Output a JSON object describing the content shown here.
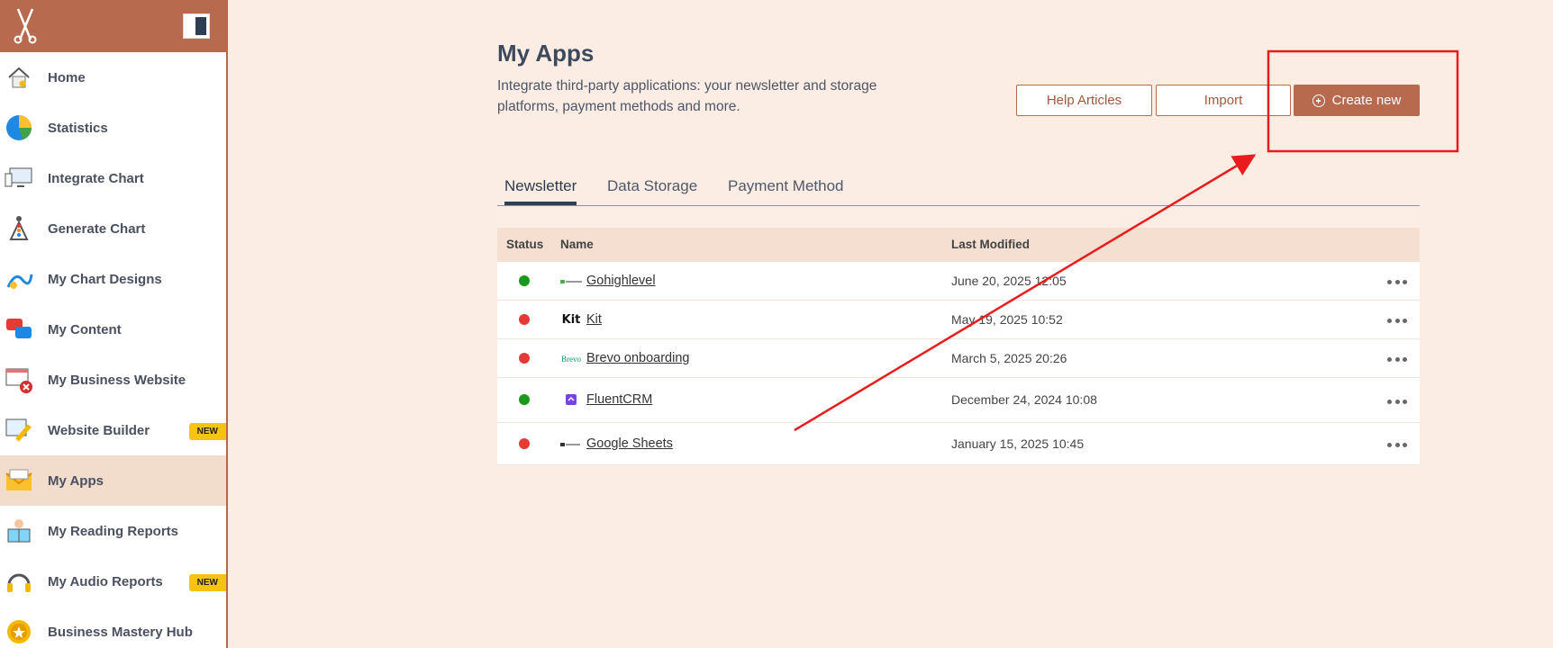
{
  "sidebar": {
    "items": [
      {
        "label": "Home",
        "icon": "home-icon"
      },
      {
        "label": "Statistics",
        "icon": "pie-chart-icon"
      },
      {
        "label": "Integrate Chart",
        "icon": "devices-icon"
      },
      {
        "label": "Generate Chart",
        "icon": "chakra-figure-icon"
      },
      {
        "label": "My Chart Designs",
        "icon": "design-icon"
      },
      {
        "label": "My Content",
        "icon": "chat-bubbles-icon"
      },
      {
        "label": "My Business Website",
        "icon": "website-error-icon"
      },
      {
        "label": "Website Builder",
        "icon": "builder-tools-icon",
        "badge": "NEW"
      },
      {
        "label": "My Apps",
        "icon": "envelope-icon",
        "active": true
      },
      {
        "label": "My Reading Reports",
        "icon": "reading-icon"
      },
      {
        "label": "My Audio Reports",
        "icon": "headphones-icon",
        "badge": "NEW"
      },
      {
        "label": "Business Mastery Hub",
        "icon": "medal-icon"
      }
    ]
  },
  "page": {
    "title": "My Apps",
    "description": "Integrate third-party applications: your newsletter and storage platforms, payment methods and more."
  },
  "buttons": {
    "help": "Help Articles",
    "import": "Import",
    "create": "Create new"
  },
  "tabs": [
    "Newsletter",
    "Data Storage",
    "Payment Method"
  ],
  "table": {
    "headers": {
      "status": "Status",
      "name": "Name",
      "modified": "Last Modified"
    },
    "rows": [
      {
        "name": "Gohighlevel",
        "date": "June 20, 2025 12:05",
        "status": "active",
        "logo_text": ""
      },
      {
        "name": "Kit",
        "date": "May 19, 2025 10:52",
        "status": "inactive",
        "logo_text": "Kit"
      },
      {
        "name": "Brevo onboarding",
        "date": "March 5, 2025 20:26",
        "status": "inactive",
        "logo_text": "Brevo"
      },
      {
        "name": "FluentCRM",
        "date": "December 24, 2024 10:08",
        "status": "active",
        "logo_text": ""
      },
      {
        "name": "Google Sheets",
        "date": "January 15, 2025 10:45",
        "status": "inactive",
        "logo_text": ""
      }
    ]
  },
  "colors": {
    "brand": "#b86a4e",
    "active": "#1a9a1a",
    "inactive": "#e53935",
    "annotation": "#e81c1c"
  }
}
